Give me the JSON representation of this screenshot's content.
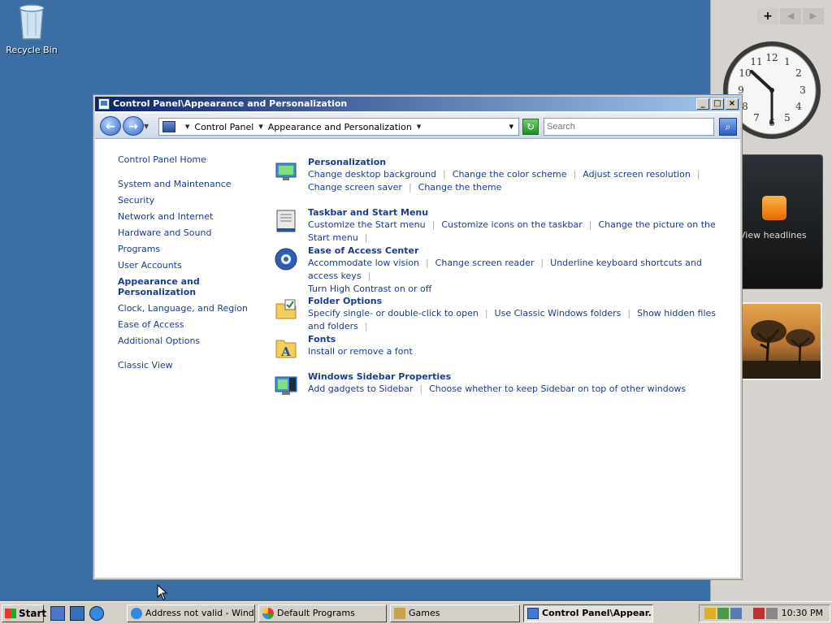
{
  "desktop": {
    "icons": [
      {
        "label": "Recycle Bin",
        "icon": "recycle-bin-icon"
      }
    ]
  },
  "sidebar": {
    "add_label": "+",
    "prev_label": "◀",
    "next_label": "▶",
    "feed_text": "View headlines"
  },
  "window": {
    "title": "Control Panel\\Appearance and Personalization",
    "controls": {
      "minimize": "_",
      "maximize": "□",
      "close": "×"
    },
    "nav": {
      "back": "←",
      "forward": "→"
    },
    "address": {
      "crumbs": [
        "Control Panel",
        "Appearance and Personalization"
      ]
    },
    "search": {
      "placeholder": "Search"
    },
    "leftnav": {
      "home": "Control Panel Home",
      "items": [
        "System and Maintenance",
        "Security",
        "Network and Internet",
        "Hardware and Sound",
        "Programs",
        "User Accounts",
        "Appearance and Personalization",
        "Clock, Language, and Region",
        "Ease of Access",
        "Additional Options"
      ],
      "current_index": 6,
      "classic": "Classic View"
    },
    "categories": [
      {
        "title": "Personalization",
        "icon": "personalization-icon",
        "links": [
          [
            "Change desktop background",
            "Change the color scheme",
            "Adjust screen resolution"
          ],
          [
            "Change screen saver",
            "Change the theme"
          ]
        ]
      },
      {
        "title": "Taskbar and Start Menu",
        "icon": "taskbar-icon",
        "links": [
          [
            "Customize the Start menu",
            "Customize icons on the taskbar",
            "Change the picture on the Start menu"
          ]
        ]
      },
      {
        "title": "Ease of Access Center",
        "icon": "ease-of-access-icon",
        "links": [
          [
            "Accommodate low vision",
            "Change screen reader",
            "Underline keyboard shortcuts and access keys"
          ],
          [
            "Turn High Contrast on or off"
          ]
        ]
      },
      {
        "title": "Folder Options",
        "icon": "folder-options-icon",
        "links": [
          [
            "Specify single- or double-click to open",
            "Use Classic Windows folders",
            "Show hidden files and folders"
          ]
        ]
      },
      {
        "title": "Fonts",
        "icon": "fonts-icon",
        "links": [
          [
            "Install or remove a font"
          ]
        ]
      },
      {
        "title": "Windows Sidebar Properties",
        "icon": "sidebar-properties-icon",
        "links": [
          [
            "Add gadgets to Sidebar",
            "Choose whether to keep Sidebar on top of other windows"
          ]
        ]
      }
    ]
  },
  "taskbar": {
    "start_label": "Start",
    "tasks": [
      {
        "label": "Address not valid - Wind...",
        "icon": "ie-icon",
        "active": false
      },
      {
        "label": "Default Programs",
        "icon": "default-programs-icon",
        "active": false
      },
      {
        "label": "Games",
        "icon": "games-icon",
        "active": false
      },
      {
        "label": "Control Panel\\Appear...",
        "icon": "control-panel-icon",
        "active": true
      }
    ],
    "clock": "10:30 PM"
  },
  "colors": {
    "desktop": "#3b6ea5",
    "link": "#1a3d8f",
    "titlebar_start": "#0a246a",
    "titlebar_end": "#a6caf0"
  }
}
